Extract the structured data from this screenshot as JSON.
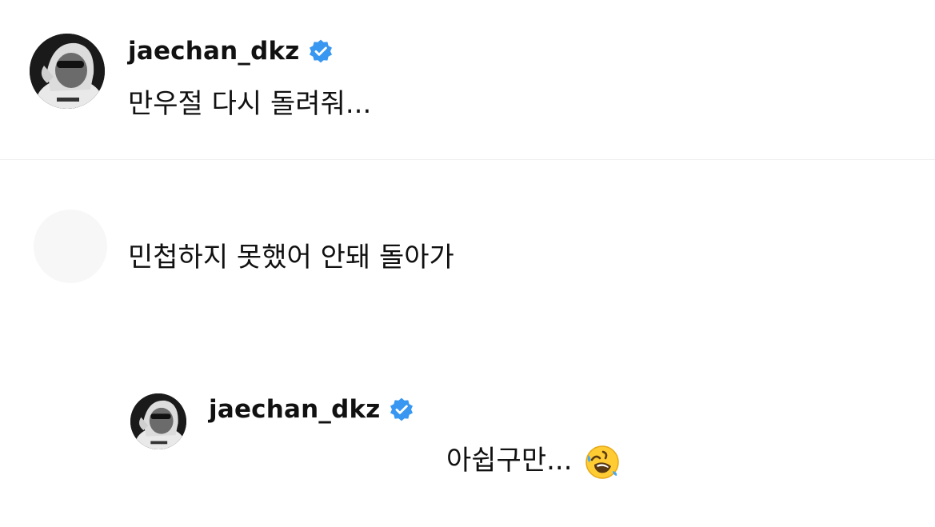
{
  "comments": [
    {
      "username": "jaechan_dkz",
      "verified": true,
      "text": "만우절 다시 돌려줘..."
    },
    {
      "username": "",
      "verified": false,
      "text": "민첩하지 못했어 안돼 돌아가"
    },
    {
      "username": "jaechan_dkz",
      "verified": true,
      "text": "아쉽구만...",
      "emoji": "rolling-on-floor-laughing-icon"
    }
  ],
  "colors": {
    "verified_badge": "#3897f0",
    "text": "#111111",
    "background": "#ffffff"
  }
}
